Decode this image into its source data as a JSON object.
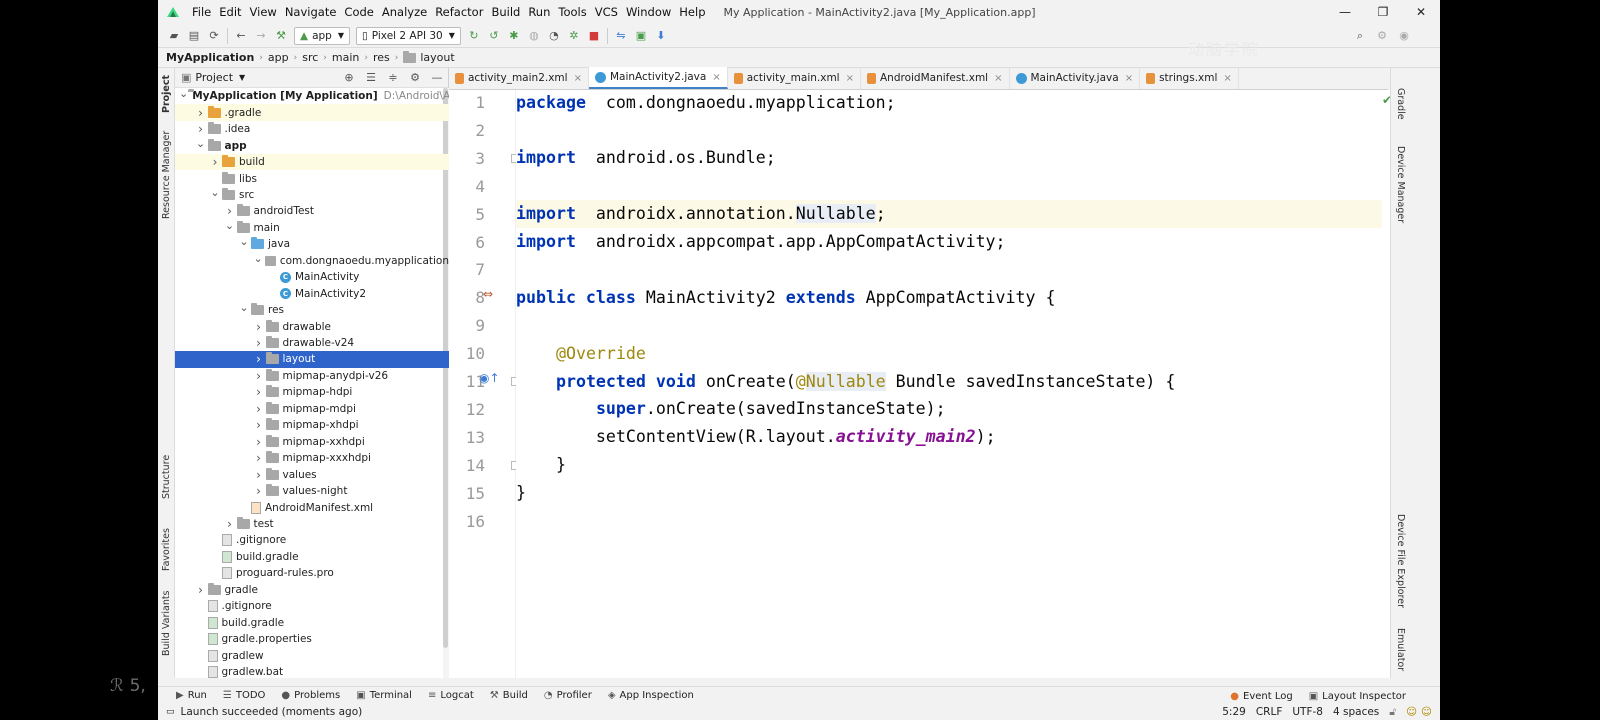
{
  "window": {
    "title": "My Application - MainActivity2.java [My_Application.app]"
  },
  "menu": [
    "File",
    "Edit",
    "View",
    "Navigate",
    "Code",
    "Analyze",
    "Refactor",
    "Build",
    "Run",
    "Tools",
    "VCS",
    "Window",
    "Help"
  ],
  "toolbar": {
    "module": "app",
    "device": "Pixel 2 API 30"
  },
  "watermark": "动脑学院",
  "breadcrumb": [
    "MyApplication",
    "app",
    "src",
    "main",
    "res",
    "layout"
  ],
  "left_strip": {
    "project": "Project",
    "resource_manager": "Resource Manager",
    "structure": "Structure",
    "favorites": "Favorites",
    "build_variants": "Build Variants"
  },
  "right_strip": {
    "gradle": "Gradle",
    "device_manager": "Device Manager",
    "device_file_explorer": "Device File Explorer",
    "emulator": "Emulator"
  },
  "project_panel": {
    "title": "Project"
  },
  "tree": [
    {
      "label": "MyApplication [My Application]",
      "sub": "D:\\Android\\Andr",
      "depth": 0,
      "arrow": "down",
      "icon": "module",
      "bold": true
    },
    {
      "label": ".gradle",
      "depth": 1,
      "arrow": "right",
      "icon": "folder-orange",
      "hl": true
    },
    {
      "label": ".idea",
      "depth": 1,
      "arrow": "right",
      "icon": "folder-gray"
    },
    {
      "label": "app",
      "depth": 1,
      "arrow": "down",
      "icon": "folder-gray",
      "bold": true
    },
    {
      "label": "build",
      "depth": 2,
      "arrow": "right",
      "icon": "folder-orange",
      "hl": true
    },
    {
      "label": "libs",
      "depth": 2,
      "arrow": "",
      "icon": "folder-gray"
    },
    {
      "label": "src",
      "depth": 2,
      "arrow": "down",
      "icon": "folder-gray"
    },
    {
      "label": "androidTest",
      "depth": 3,
      "arrow": "right",
      "icon": "folder-gray"
    },
    {
      "label": "main",
      "depth": 3,
      "arrow": "down",
      "icon": "folder-gray"
    },
    {
      "label": "java",
      "depth": 4,
      "arrow": "down",
      "icon": "folder-blue"
    },
    {
      "label": "com.dongnaoedu.myapplication",
      "depth": 5,
      "arrow": "down",
      "icon": "package"
    },
    {
      "label": "MainActivity",
      "depth": 6,
      "arrow": "",
      "icon": "class"
    },
    {
      "label": "MainActivity2",
      "depth": 6,
      "arrow": "",
      "icon": "class"
    },
    {
      "label": "res",
      "depth": 4,
      "arrow": "down",
      "icon": "folder-res"
    },
    {
      "label": "drawable",
      "depth": 5,
      "arrow": "right",
      "icon": "folder-gray"
    },
    {
      "label": "drawable-v24",
      "depth": 5,
      "arrow": "right",
      "icon": "folder-gray"
    },
    {
      "label": "layout",
      "depth": 5,
      "arrow": "right",
      "icon": "folder-gray",
      "selected": true
    },
    {
      "label": "mipmap-anydpi-v26",
      "depth": 5,
      "arrow": "right",
      "icon": "folder-gray"
    },
    {
      "label": "mipmap-hdpi",
      "depth": 5,
      "arrow": "right",
      "icon": "folder-gray"
    },
    {
      "label": "mipmap-mdpi",
      "depth": 5,
      "arrow": "right",
      "icon": "folder-gray"
    },
    {
      "label": "mipmap-xhdpi",
      "depth": 5,
      "arrow": "right",
      "icon": "folder-gray"
    },
    {
      "label": "mipmap-xxhdpi",
      "depth": 5,
      "arrow": "right",
      "icon": "folder-gray"
    },
    {
      "label": "mipmap-xxxhdpi",
      "depth": 5,
      "arrow": "right",
      "icon": "folder-gray"
    },
    {
      "label": "values",
      "depth": 5,
      "arrow": "right",
      "icon": "folder-gray"
    },
    {
      "label": "values-night",
      "depth": 5,
      "arrow": "right",
      "icon": "folder-gray"
    },
    {
      "label": "AndroidManifest.xml",
      "depth": 4,
      "arrow": "",
      "icon": "file-xml"
    },
    {
      "label": "test",
      "depth": 3,
      "arrow": "right",
      "icon": "folder-gray"
    },
    {
      "label": ".gitignore",
      "depth": 2,
      "arrow": "",
      "icon": "file"
    },
    {
      "label": "build.gradle",
      "depth": 2,
      "arrow": "",
      "icon": "file-gradle"
    },
    {
      "label": "proguard-rules.pro",
      "depth": 2,
      "arrow": "",
      "icon": "file"
    },
    {
      "label": "gradle",
      "depth": 1,
      "arrow": "right",
      "icon": "folder-gray"
    },
    {
      "label": ".gitignore",
      "depth": 1,
      "arrow": "",
      "icon": "file"
    },
    {
      "label": "build.gradle",
      "depth": 1,
      "arrow": "",
      "icon": "file-gradle"
    },
    {
      "label": "gradle.properties",
      "depth": 1,
      "arrow": "",
      "icon": "file-gradle"
    },
    {
      "label": "gradlew",
      "depth": 1,
      "arrow": "",
      "icon": "file"
    },
    {
      "label": "gradlew.bat",
      "depth": 1,
      "arrow": "",
      "icon": "file"
    }
  ],
  "tabs": [
    {
      "label": "activity_main2.xml",
      "icon": "xml"
    },
    {
      "label": "MainActivity2.java",
      "icon": "c",
      "active": true
    },
    {
      "label": "activity_main.xml",
      "icon": "xml"
    },
    {
      "label": "AndroidManifest.xml",
      "icon": "xml"
    },
    {
      "label": "MainActivity.java",
      "icon": "c"
    },
    {
      "label": "strings.xml",
      "icon": "xml"
    }
  ],
  "code": [
    {
      "n": "1",
      "parts": [
        [
          "kw",
          "package"
        ],
        [
          "",
          "  com.dongnaoedu.myapplication;"
        ]
      ]
    },
    {
      "n": "2",
      "parts": []
    },
    {
      "n": "3",
      "parts": [
        [
          "kw",
          "import"
        ],
        [
          "",
          "  android.os.Bundle;"
        ]
      ]
    },
    {
      "n": "4",
      "parts": []
    },
    {
      "n": "5",
      "cur": true,
      "parts": [
        [
          "kw",
          "import"
        ],
        [
          "",
          "  androidx.annotation."
        ],
        [
          "nullhl",
          "Nullable"
        ],
        [
          "",
          ";"
        ]
      ]
    },
    {
      "n": "6",
      "parts": [
        [
          "kw",
          "import"
        ],
        [
          "",
          "  androidx.appcompat.app.AppCompatActivity;"
        ]
      ]
    },
    {
      "n": "7",
      "parts": []
    },
    {
      "n": "8",
      "parts": [
        [
          "kw",
          "public class"
        ],
        [
          "",
          " MainActivity2 "
        ],
        [
          "kw",
          "extends"
        ],
        [
          "",
          " AppCompatActivity {"
        ]
      ]
    },
    {
      "n": "9",
      "parts": []
    },
    {
      "n": "10",
      "parts": [
        [
          "",
          "    "
        ],
        [
          "ann",
          "@Override"
        ]
      ]
    },
    {
      "n": "11",
      "parts": [
        [
          "",
          "    "
        ],
        [
          "kw",
          "protected void"
        ],
        [
          "",
          " onCreate("
        ],
        [
          "ann",
          "@"
        ],
        [
          "ann nullhl",
          "Nullable"
        ],
        [
          "",
          " Bundle savedInstanceState) {"
        ]
      ]
    },
    {
      "n": "12",
      "parts": [
        [
          "",
          "        "
        ],
        [
          "kw",
          "super"
        ],
        [
          "",
          ".onCreate(savedInstanceState);"
        ]
      ]
    },
    {
      "n": "13",
      "parts": [
        [
          "",
          "        setContentView(R.layout."
        ],
        [
          "ital",
          "activity_main2"
        ],
        [
          "",
          ");"
        ]
      ]
    },
    {
      "n": "14",
      "parts": [
        [
          "",
          "    }"
        ]
      ]
    },
    {
      "n": "15",
      "parts": [
        [
          "",
          "}"
        ]
      ]
    },
    {
      "n": "16",
      "parts": []
    }
  ],
  "bottom_tabs": [
    {
      "label": "Run",
      "icon": "▶"
    },
    {
      "label": "TODO",
      "icon": "☰"
    },
    {
      "label": "Problems",
      "icon": "●"
    },
    {
      "label": "Terminal",
      "icon": "▣"
    },
    {
      "label": "Logcat",
      "icon": "≡"
    },
    {
      "label": "Build",
      "icon": "⚒"
    },
    {
      "label": "Profiler",
      "icon": "◔"
    },
    {
      "label": "App Inspection",
      "icon": "◈"
    }
  ],
  "bottom_right_tabs": [
    {
      "label": "Event Log",
      "icon": "●"
    },
    {
      "label": "Layout Inspector",
      "icon": "▣"
    }
  ],
  "status": {
    "message": "Launch succeeded (moments ago)",
    "position": "5:29",
    "line_sep": "CRLF",
    "encoding": "UTF-8",
    "indent": "4 spaces"
  },
  "video_overlay": "5,"
}
